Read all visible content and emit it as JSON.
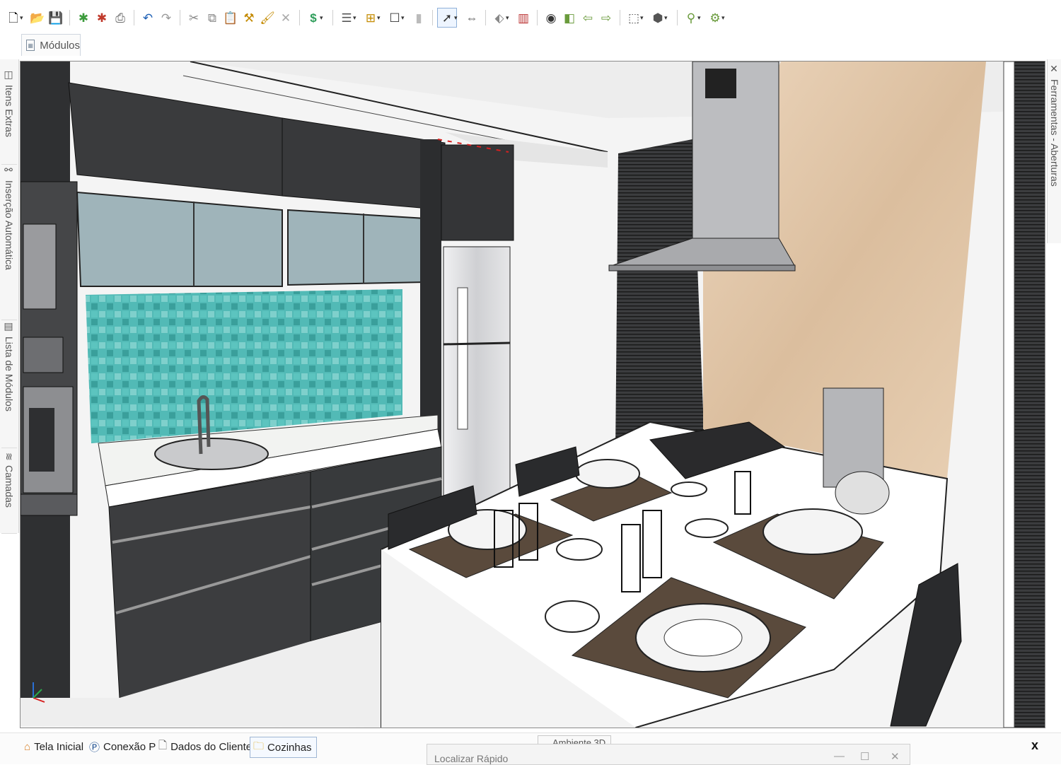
{
  "toolbar": {
    "groups": [
      {
        "icons": [
          "new-file-icon",
          "open-folder-icon",
          "save-icon"
        ]
      },
      {
        "icons": [
          "render-green-icon",
          "render-red-icon",
          "print-icon"
        ]
      },
      {
        "icons": [
          "undo-icon",
          "redo-icon"
        ]
      },
      {
        "icons": [
          "cut-icon",
          "copy-icon",
          "paste-icon",
          "paint-icon",
          "brush-icon",
          "delete-icon"
        ]
      },
      {
        "icons": [
          "budget-icon"
        ]
      },
      {
        "icons": [
          "list-icon",
          "hierarchy-icon",
          "box-icon",
          "block-icon"
        ]
      },
      {
        "icons": [
          "select-cursor-icon",
          "measure-icon"
        ]
      },
      {
        "icons": [
          "pin-icon",
          "ruler-icon"
        ]
      },
      {
        "icons": [
          "view-eye-icon",
          "door-icon",
          "arrow-left-icon",
          "arrow-right-icon"
        ]
      },
      {
        "icons": [
          "cube-frame-icon",
          "cube-solid-icon"
        ]
      },
      {
        "icons": [
          "wand-icon",
          "gear-green-icon"
        ]
      }
    ]
  },
  "ribbon": {
    "tab_label": "Módulos"
  },
  "left_panel": {
    "tabs": [
      {
        "label": "Itens Extras"
      },
      {
        "label": "Inserção Automática"
      },
      {
        "label": "Lista de Módulos"
      },
      {
        "label": "Camadas"
      }
    ]
  },
  "right_panel": {
    "tab_label": "Ferramentas - Aberturas"
  },
  "taskbar": {
    "tabs": [
      {
        "label": "Tela Inicial",
        "icon": "home-icon"
      },
      {
        "label": "Conexão P",
        "icon": "connection-icon"
      },
      {
        "label": "Dados do Cliente",
        "icon": "document-icon"
      },
      {
        "label": "Cozinhas",
        "icon": "folder-icon",
        "active": true
      }
    ],
    "close_label": "x",
    "env_tab_label": "Ambiente 3D"
  },
  "floating_window": {
    "title": "Localizar Rápido",
    "minimize": "—",
    "maximize": "☐",
    "close": "✕"
  },
  "scene": {
    "description_colors": {
      "cabinet": "#3a3b3d",
      "tile": "#4fb8b4",
      "wood": "#e2c9ad",
      "counter": "#ffffff",
      "fridge": "#dcdde0"
    }
  }
}
